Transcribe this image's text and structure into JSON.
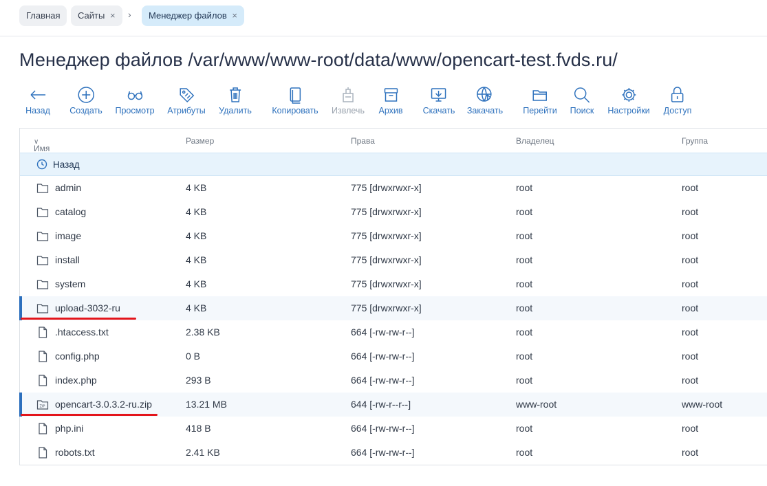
{
  "breadcrumbs": [
    {
      "label": "Главная"
    },
    {
      "label": "Сайты",
      "close": "×"
    },
    {
      "label": "Менеджер файлов",
      "close": "×"
    }
  ],
  "breadcrumb_separator": "›",
  "page_title": "Менеджер файлов /var/www/www-root/data/www/opencart-test.fvds.ru/",
  "toolbar": [
    {
      "label": "Назад",
      "icon": "arrow-left-icon"
    },
    {
      "label": "Создать",
      "icon": "plus-circle-icon"
    },
    {
      "label": "Просмотр",
      "icon": "glasses-icon"
    },
    {
      "label": "Атрибуты",
      "icon": "tag-icon"
    },
    {
      "label": "Удалить",
      "icon": "trash-icon"
    },
    {
      "label": "Копировать",
      "icon": "copy-icon"
    },
    {
      "label": "Извлечь",
      "icon": "extract-icon",
      "disabled": true
    },
    {
      "label": "Архив",
      "icon": "archive-icon"
    },
    {
      "label": "Скачать",
      "icon": "download-icon"
    },
    {
      "label": "Закачать",
      "icon": "upload-globe-icon"
    },
    {
      "label": "Перейти",
      "icon": "folder-open-icon"
    },
    {
      "label": "Поиск",
      "icon": "search-icon"
    },
    {
      "label": "Настройки",
      "icon": "gear-icon"
    },
    {
      "label": "Доступ",
      "icon": "lock-icon"
    }
  ],
  "table": {
    "headers": {
      "name": "Имя",
      "sort_indicator": "∨",
      "size": "Размер",
      "rights": "Права",
      "owner": "Владелец",
      "group": "Группа"
    },
    "back_label": "Назад",
    "rows": [
      {
        "name": "admin",
        "size": "4 KB",
        "rights": "775 [drwxrwxr-x]",
        "owner": "root",
        "group": "root",
        "type": "folder"
      },
      {
        "name": "catalog",
        "size": "4 KB",
        "rights": "775 [drwxrwxr-x]",
        "owner": "root",
        "group": "root",
        "type": "folder"
      },
      {
        "name": "image",
        "size": "4 KB",
        "rights": "775 [drwxrwxr-x]",
        "owner": "root",
        "group": "root",
        "type": "folder"
      },
      {
        "name": "install",
        "size": "4 KB",
        "rights": "775 [drwxrwxr-x]",
        "owner": "root",
        "group": "root",
        "type": "folder"
      },
      {
        "name": "system",
        "size": "4 KB",
        "rights": "775 [drwxrwxr-x]",
        "owner": "root",
        "group": "root",
        "type": "folder"
      },
      {
        "name": "upload-3032-ru",
        "size": "4 KB",
        "rights": "775 [drwxrwxr-x]",
        "owner": "root",
        "group": "root",
        "type": "folder",
        "highlighted": true
      },
      {
        "name": ".htaccess.txt",
        "size": "2.38 KB",
        "rights": "664 [-rw-rw-r--]",
        "owner": "root",
        "group": "root",
        "type": "file"
      },
      {
        "name": "config.php",
        "size": "0 B",
        "rights": "664 [-rw-rw-r--]",
        "owner": "root",
        "group": "root",
        "type": "file"
      },
      {
        "name": "index.php",
        "size": "293 B",
        "rights": "664 [-rw-rw-r--]",
        "owner": "root",
        "group": "root",
        "type": "file"
      },
      {
        "name": "opencart-3.0.3.2-ru.zip",
        "size": "13.21 MB",
        "rights": "644 [-rw-r--r--]",
        "owner": "www-root",
        "group": "www-root",
        "type": "zip",
        "highlighted": true
      },
      {
        "name": "php.ini",
        "size": "418 B",
        "rights": "664 [-rw-rw-r--]",
        "owner": "root",
        "group": "root",
        "type": "file"
      },
      {
        "name": "robots.txt",
        "size": "2.41 KB",
        "rights": "664 [-rw-rw-r--]",
        "owner": "root",
        "group": "root",
        "type": "file"
      }
    ]
  },
  "colors": {
    "accent": "#2f72bd",
    "highlight_bar": "#2c6fbd",
    "annotation": "#e3151b"
  }
}
